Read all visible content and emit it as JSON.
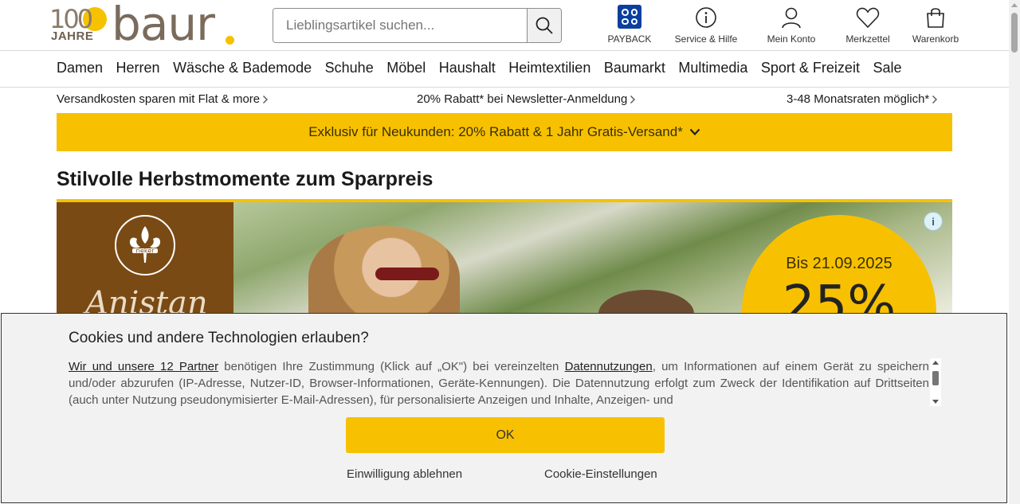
{
  "header": {
    "logo": {
      "jubilee_number": "100",
      "jubilee_word": "JAHRE",
      "brand": "baur"
    },
    "search": {
      "placeholder": "Lieblingsartikel suchen...",
      "icon": "search-icon"
    },
    "icons": [
      {
        "label": "PAYBACK",
        "icon": "payback-icon"
      },
      {
        "label": "Service & Hilfe",
        "icon": "info-icon"
      },
      {
        "label": "Mein Konto",
        "icon": "user-icon"
      },
      {
        "label": "Merkzettel",
        "icon": "heart-icon"
      },
      {
        "label": "Warenkorb",
        "icon": "shopping-bag-icon"
      }
    ]
  },
  "nav": {
    "items": [
      "Damen",
      "Herren",
      "Wäsche & Bademode",
      "Schuhe",
      "Möbel",
      "Haushalt",
      "Heimtextilien",
      "Baumarkt",
      "Multimedia",
      "Sport & Freizeit",
      "Sale"
    ]
  },
  "usps": [
    "Versandkosten sparen mit Flat & more",
    "20% Rabatt* bei Newsletter-Anmeldung",
    "3-48 Monatsraten möglich*"
  ],
  "promo": {
    "text": "Exklusiv für Neukunden: 20% Rabatt & 1 Jahr Gratis-Versand*"
  },
  "headline": "Stilvolle Herbstmomente zum Sparpreis",
  "teaser": {
    "brand": "rieker",
    "script_text": "Anistan",
    "until": "Bis 21.09.2025",
    "discount": "25%",
    "info_glyph": "i"
  },
  "cookie": {
    "title": "Cookies und andere Technologien erlauben?",
    "partners_link": "Wir und unsere 12 Partner",
    "body_a": " benötigen Ihre Zustimmung (Klick auf „OK\") bei vereinzelten ",
    "data_link": "Datennutzungen",
    "body_b": ", um Informationen auf einem Gerät zu speichern und/oder abzurufen (IP-Adresse, Nutzer-ID, Browser-Informationen, Geräte-Kennungen). Die Datennutzung erfolgt zum Zweck der Identifikation auf Drittseiten (auch unter Nutzung pseudonymisierter E-Mail-Adressen), für personalisierte Anzeigen und Inhalte, Anzeigen- und",
    "ok_label": "OK",
    "decline_label": "Einwilligung ablehnen",
    "settings_label": "Cookie-Einstellungen"
  },
  "colors": {
    "accent": "#f7c101",
    "brand": "#7a6b5c",
    "payback": "#0a3fa0"
  }
}
